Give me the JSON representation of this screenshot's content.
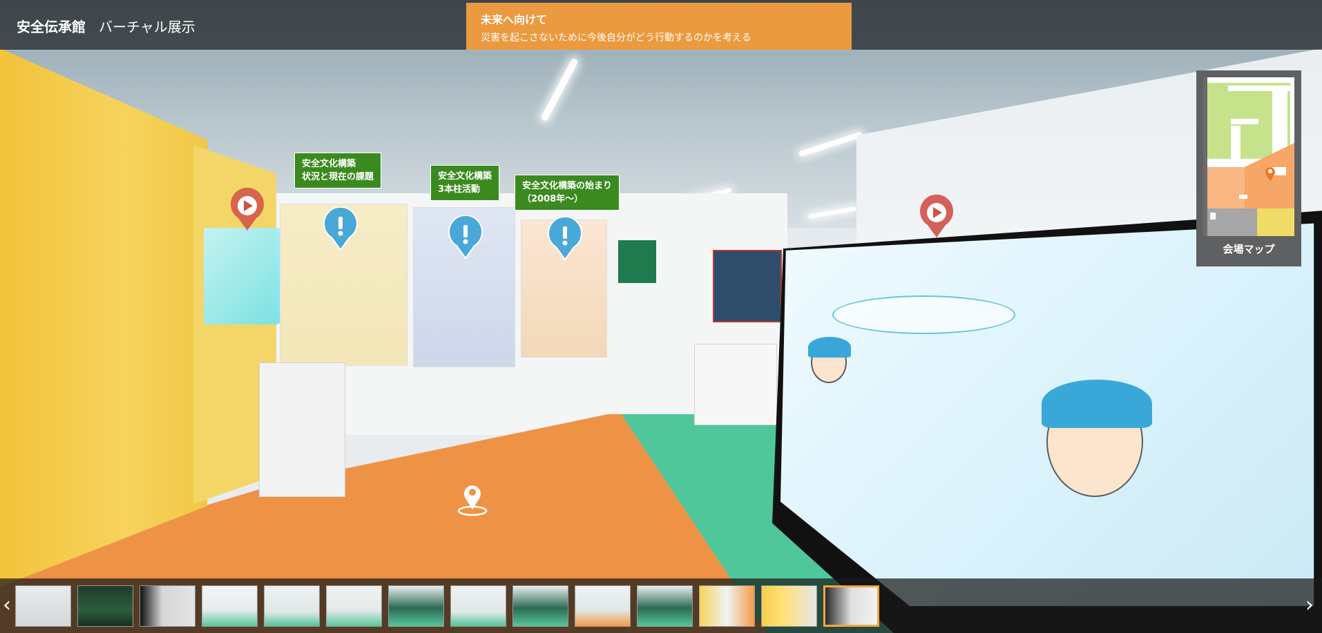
{
  "header": {
    "brand": "安全伝承館",
    "subtitle": "バーチャル展示",
    "section_title": "未来へ向けて",
    "section_description": "災害を起こさないために今後自分がどう行動するのかを考える"
  },
  "hotspots": [
    {
      "label": "安全文化構築\n状況と現在の課題",
      "icon": "info-pin-icon"
    },
    {
      "label": "安全文化構築\n3本柱活動",
      "icon": "info-pin-icon"
    },
    {
      "label": "安全文化構築の始まり\n（2008年～）",
      "icon": "info-pin-icon"
    }
  ],
  "video_hotspots": [
    {
      "icon": "play-pin-icon"
    },
    {
      "icon": "play-pin-icon"
    }
  ],
  "nav_hotspot": {
    "icon": "location-pin-icon"
  },
  "map": {
    "label": "会場マップ",
    "current_marker_icon": "location-pin-icon"
  },
  "thumbnail_nav": {
    "prev_icon": "chevron-left-icon",
    "next_icon": "chevron-right-icon",
    "count": 14,
    "active_index": 13
  },
  "colors": {
    "accent_orange": "#eb9a3f",
    "label_green": "#3a8a1f",
    "info_blue": "#4aa8d8",
    "play_red": "#d2504a"
  }
}
